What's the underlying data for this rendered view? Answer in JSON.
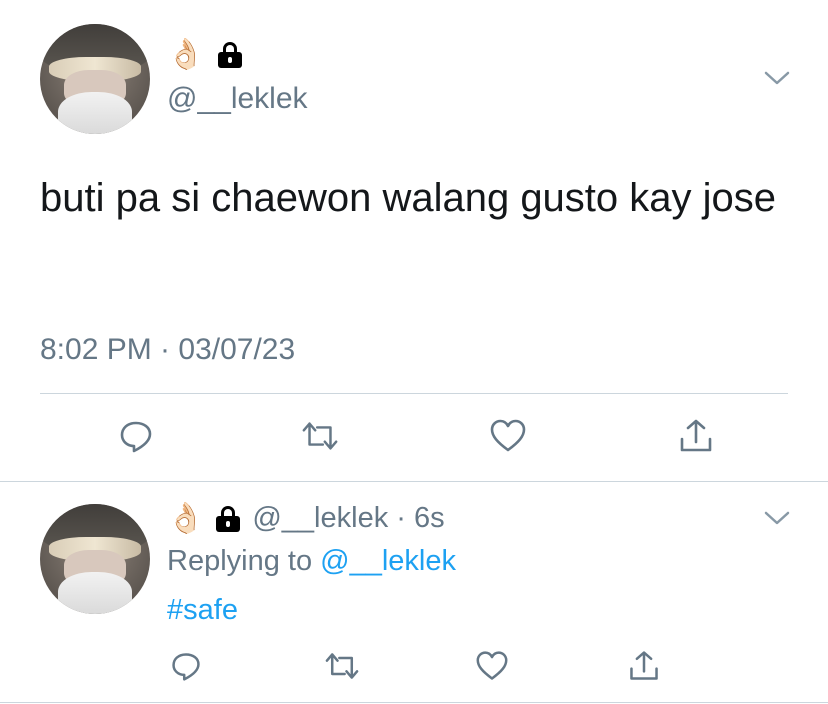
{
  "main_tweet": {
    "emoji": "👌🏻",
    "handle": "@__leklek",
    "text": "buti pa si chaewon walang gusto kay jose",
    "timestamp": "8:02 PM · 03/07/23"
  },
  "reply_tweet": {
    "emoji": "👌🏻",
    "handle_time": "@__leklek · 6s",
    "replying_prefix": "Replying to ",
    "replying_handle": "@__leklek",
    "hashtag": "#safe"
  },
  "icons": {
    "reply": "reply-icon",
    "retweet": "retweet-icon",
    "like": "like-icon",
    "share": "share-icon",
    "lock": "lock-icon",
    "menu": "chevron-down-icon"
  },
  "colors": {
    "text": "#14171a",
    "secondary": "#657786",
    "link": "#1da1f2",
    "divider": "#ccd6dd"
  }
}
